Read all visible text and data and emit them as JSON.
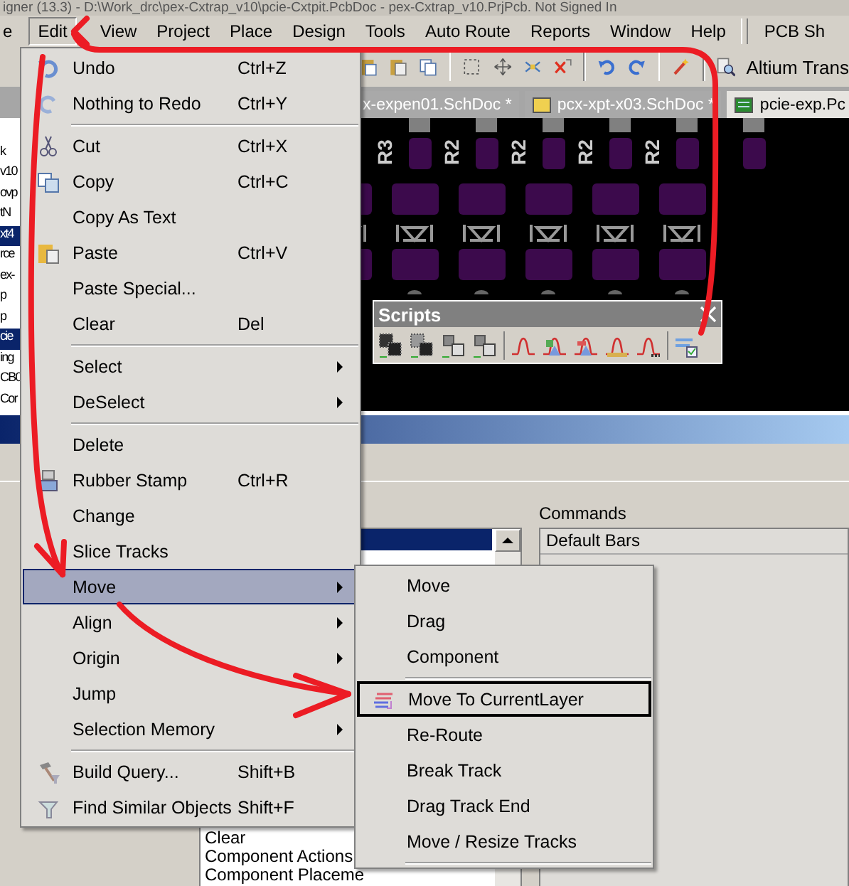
{
  "window": {
    "title": "igner (13.3) - D:\\Work_drc\\pex-Cxtrap_v10\\pcie-Cxtpit.PcbDoc - pex-Cxtrap_v10.PrjPcb. Not Signed In"
  },
  "menubar": [
    {
      "label": "e",
      "selected": false
    },
    {
      "label": "Edit",
      "selected": true
    },
    {
      "label": "View",
      "selected": false
    },
    {
      "label": "Project",
      "selected": false
    },
    {
      "label": "Place",
      "selected": false
    },
    {
      "label": "Design",
      "selected": false
    },
    {
      "label": "Tools",
      "selected": false
    },
    {
      "label": "Auto Route",
      "selected": false
    },
    {
      "label": "Reports",
      "selected": false
    },
    {
      "label": "Window",
      "selected": false
    },
    {
      "label": "Help",
      "selected": false
    }
  ],
  "menubar_extra": "PCB Sh",
  "toolbar": {
    "label": "Altium Trans"
  },
  "doc_tabs": [
    {
      "label": "x-expen01.SchDoc *",
      "selected": false
    },
    {
      "label": "pcx-xpt-x03.SchDoc *",
      "selected": false
    },
    {
      "label": "pcie-exp.Pc",
      "selected": true
    }
  ],
  "left_panel": [
    {
      "text": "k",
      "selected": false
    },
    {
      "text": "v10",
      "selected": false
    },
    {
      "text": "ovp",
      "selected": false
    },
    {
      "text": "tN",
      "selected": false
    },
    {
      "text": "xt4",
      "selected": true
    },
    {
      "text": "rce",
      "selected": false
    },
    {
      "text": "ex-",
      "selected": false
    },
    {
      "text": "p",
      "selected": false
    },
    {
      "text": "p",
      "selected": false
    },
    {
      "text": "cie",
      "selected": true
    },
    {
      "text": "ing",
      "selected": false
    },
    {
      "text": "CB0",
      "selected": false
    },
    {
      "text": "Cor",
      "selected": false
    }
  ],
  "pcb": {
    "designators": [
      "R3",
      "R2",
      "R2",
      "R2",
      "R2"
    ]
  },
  "scripts_toolbar": {
    "title": "Scripts"
  },
  "dialog": {
    "commands_label": "Commands",
    "categories_header": "Default Bars",
    "list_items": [
      "Clear",
      "Component Actions",
      "Component Placeme"
    ]
  },
  "edit_menu": [
    {
      "kind": "item",
      "label": "Undo",
      "shortcut": "Ctrl+Z",
      "submenu": false,
      "selected": false
    },
    {
      "kind": "item",
      "label": "Nothing to Redo",
      "shortcut": "Ctrl+Y",
      "submenu": false,
      "selected": false
    },
    {
      "kind": "separator"
    },
    {
      "kind": "item",
      "label": "Cut",
      "shortcut": "Ctrl+X",
      "submenu": false,
      "selected": false
    },
    {
      "kind": "item",
      "label": "Copy",
      "shortcut": "Ctrl+C",
      "submenu": false,
      "selected": false
    },
    {
      "kind": "item",
      "label": "Copy As Text",
      "submenu": false,
      "selected": false
    },
    {
      "kind": "item",
      "label": "Paste",
      "shortcut": "Ctrl+V",
      "submenu": false,
      "selected": false
    },
    {
      "kind": "item",
      "label": "Paste Special...",
      "submenu": false,
      "selected": false
    },
    {
      "kind": "item",
      "label": "Clear",
      "shortcut": "Del",
      "submenu": false,
      "selected": false
    },
    {
      "kind": "separator"
    },
    {
      "kind": "item",
      "label": "Select",
      "submenu": true,
      "selected": false
    },
    {
      "kind": "item",
      "label": "DeSelect",
      "submenu": true,
      "selected": false
    },
    {
      "kind": "separator"
    },
    {
      "kind": "item",
      "label": "Delete",
      "submenu": false,
      "selected": false
    },
    {
      "kind": "item",
      "label": "Rubber Stamp",
      "shortcut": "Ctrl+R",
      "submenu": false,
      "selected": false
    },
    {
      "kind": "item",
      "label": "Change",
      "submenu": false,
      "selected": false
    },
    {
      "kind": "item",
      "label": "Slice Tracks",
      "submenu": false,
      "selected": false
    },
    {
      "kind": "item",
      "label": "Move",
      "submenu": true,
      "selected": true
    },
    {
      "kind": "item",
      "label": "Align",
      "submenu": true,
      "selected": false
    },
    {
      "kind": "item",
      "label": "Origin",
      "submenu": true,
      "selected": false
    },
    {
      "kind": "item",
      "label": "Jump",
      "submenu": false,
      "selected": false
    },
    {
      "kind": "item",
      "label": "Selection Memory",
      "submenu": true,
      "selected": false
    },
    {
      "kind": "separator"
    },
    {
      "kind": "item",
      "label": "Build Query...",
      "shortcut": "Shift+B",
      "submenu": false,
      "selected": false
    },
    {
      "kind": "item",
      "label": "Find Similar Objects",
      "shortcut": "Shift+F",
      "submenu": false,
      "selected": false
    }
  ],
  "move_submenu": [
    {
      "kind": "item",
      "label": "Move",
      "selected": false
    },
    {
      "kind": "item",
      "label": "Drag",
      "selected": false
    },
    {
      "kind": "item",
      "label": "Component",
      "selected": false
    },
    {
      "kind": "separator"
    },
    {
      "kind": "item",
      "label": "Move To CurrentLayer",
      "selected": true
    },
    {
      "kind": "item",
      "label": "Re-Route",
      "selected": false
    },
    {
      "kind": "item",
      "label": "Break Track",
      "selected": false
    },
    {
      "kind": "item",
      "label": "Drag Track End",
      "selected": false
    },
    {
      "kind": "item",
      "label": "Move / Resize Tracks",
      "selected": false
    },
    {
      "kind": "separator"
    }
  ]
}
